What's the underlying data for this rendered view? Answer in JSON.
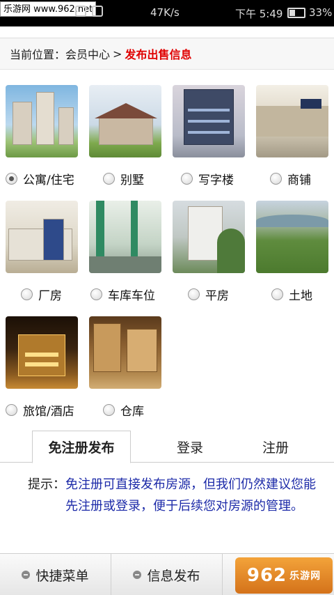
{
  "status_bar": {
    "watermark": "乐游网 www.962.net",
    "speed": "47K/s",
    "time": "下午 5:49",
    "battery": "33%"
  },
  "breadcrumb": {
    "label": "当前位置：",
    "parent": "会员中心",
    "separator": ">",
    "current": "发布出售信息"
  },
  "property_types": [
    {
      "label": "公寓/住宅",
      "checked": true
    },
    {
      "label": "别墅",
      "checked": false
    },
    {
      "label": "写字楼",
      "checked": false
    },
    {
      "label": "商铺",
      "checked": false
    },
    {
      "label": "厂房",
      "checked": false
    },
    {
      "label": "车库车位",
      "checked": false
    },
    {
      "label": "平房",
      "checked": false
    },
    {
      "label": "土地",
      "checked": false
    },
    {
      "label": "旅馆/酒店",
      "checked": false
    },
    {
      "label": "仓库",
      "checked": false
    }
  ],
  "tabs": [
    {
      "label": "免注册发布",
      "active": true
    },
    {
      "label": "登录",
      "active": false
    },
    {
      "label": "注册",
      "active": false
    }
  ],
  "tip": {
    "label": "提示：",
    "text": "免注册可直接发布房源，但我们仍然建议您能先注册或登录，便于后续您对房源的管理。"
  },
  "bottom_bar": {
    "items": [
      "快捷菜单",
      "信息发布"
    ],
    "logo_text": "962",
    "logo_sub": "乐游网"
  }
}
